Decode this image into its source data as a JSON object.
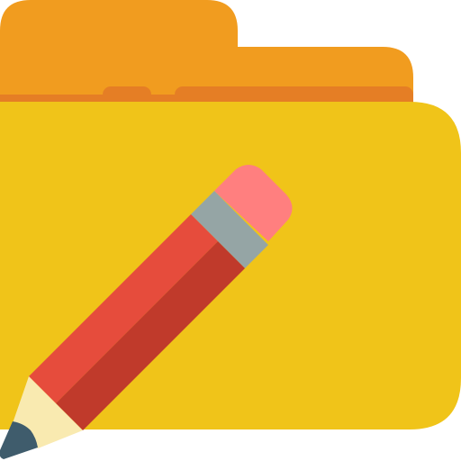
{
  "icon": {
    "name": "folder-edit-icon",
    "colors": {
      "folder_back": "#F19C1F",
      "folder_strip": "#E57E25",
      "folder_front": "#F0C419",
      "pencil_body_light": "#E64C3C",
      "pencil_body_dark": "#C03A2B",
      "pencil_band": "#95A5A5",
      "pencil_eraser": "#FF7F7F",
      "pencil_wood": "#F9EAB0",
      "pencil_lead": "#3F5C6C"
    }
  }
}
